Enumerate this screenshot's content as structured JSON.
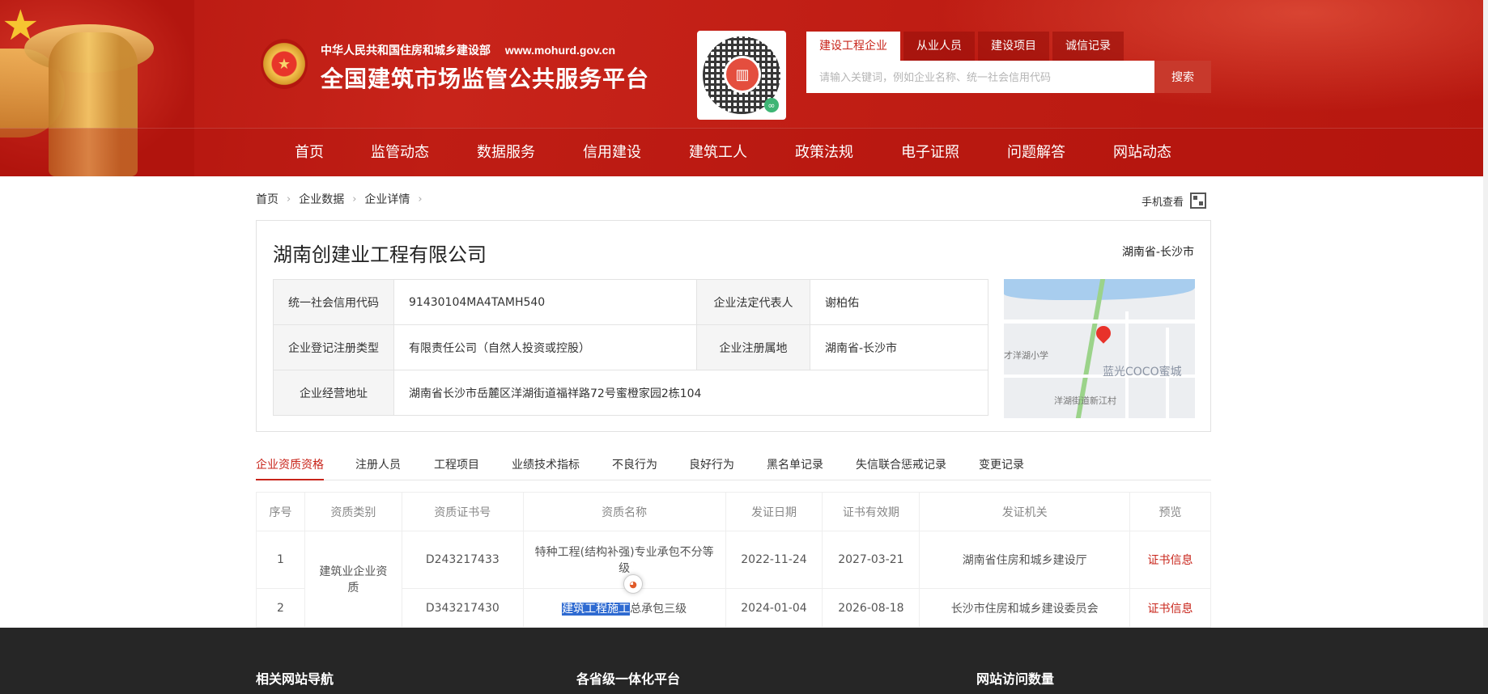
{
  "header": {
    "ministry": "中华人民共和国住房和城乡建设部",
    "url": "www.mohurd.gov.cn",
    "platform_title": "全国建筑市场监管公共服务平台",
    "search_tabs": [
      "建设工程企业",
      "从业人员",
      "建设项目",
      "诚信记录"
    ],
    "search_placeholder": "请输入关键词，例如企业名称、统一社会信用代码",
    "search_button": "搜索"
  },
  "nav": [
    "首页",
    "监管动态",
    "数据服务",
    "信用建设",
    "建筑工人",
    "政策法规",
    "电子证照",
    "问题解答",
    "网站动态"
  ],
  "breadcrumb": [
    "首页",
    "企业数据",
    "企业详情"
  ],
  "mobile_view": "手机查看",
  "company": {
    "name": "湖南创建业工程有限公司",
    "region": "湖南省-长沙市",
    "credit_code_label": "统一社会信用代码",
    "credit_code": "91430104MA4TAMH540",
    "legal_rep_label": "企业法定代表人",
    "legal_rep": "谢柏佑",
    "reg_type_label": "企业登记注册类型",
    "reg_type": "有限责任公司（自然人投资或控股）",
    "reg_place_label": "企业注册属地",
    "reg_place": "湖南省-长沙市",
    "address_label": "企业经营地址",
    "address": "湖南省长沙市岳麓区洋湖街道福祥路72号蜜橙家园2栋104"
  },
  "map": {
    "label_school": "才洋湖小学",
    "label_city": "蓝光COCO蜜城",
    "label_village": "洋湖街道新江村"
  },
  "tabs": [
    "企业资质资格",
    "注册人员",
    "工程项目",
    "业绩技术指标",
    "不良行为",
    "良好行为",
    "黑名单记录",
    "失信联合惩戒记录",
    "变更记录"
  ],
  "table": {
    "headers": [
      "序号",
      "资质类别",
      "资质证书号",
      "资质名称",
      "发证日期",
      "证书有效期",
      "发证机关",
      "预览"
    ],
    "category": "建筑业企业资质",
    "rows": [
      {
        "no": "1",
        "cert_no": "D243217433",
        "name": "特种工程(结构补强)专业承包不分等级",
        "issue": "2022-11-24",
        "expire": "2027-03-21",
        "authority": "湖南省住房和城乡建设厅",
        "preview": "证书信息"
      },
      {
        "no": "2",
        "cert_no": "D343217430",
        "name_highlight": "建筑工程施工",
        "name_rest": "总承包三级",
        "issue": "2024-01-04",
        "expire": "2026-08-18",
        "authority": "长沙市住房和城乡建设委员会",
        "preview": "证书信息"
      }
    ]
  },
  "footer": [
    "相关网站导航",
    "各省级一体化平台",
    "网站访问数量"
  ],
  "colors": {
    "brand_red": "#c8241a",
    "footer_bg": "#262626"
  }
}
